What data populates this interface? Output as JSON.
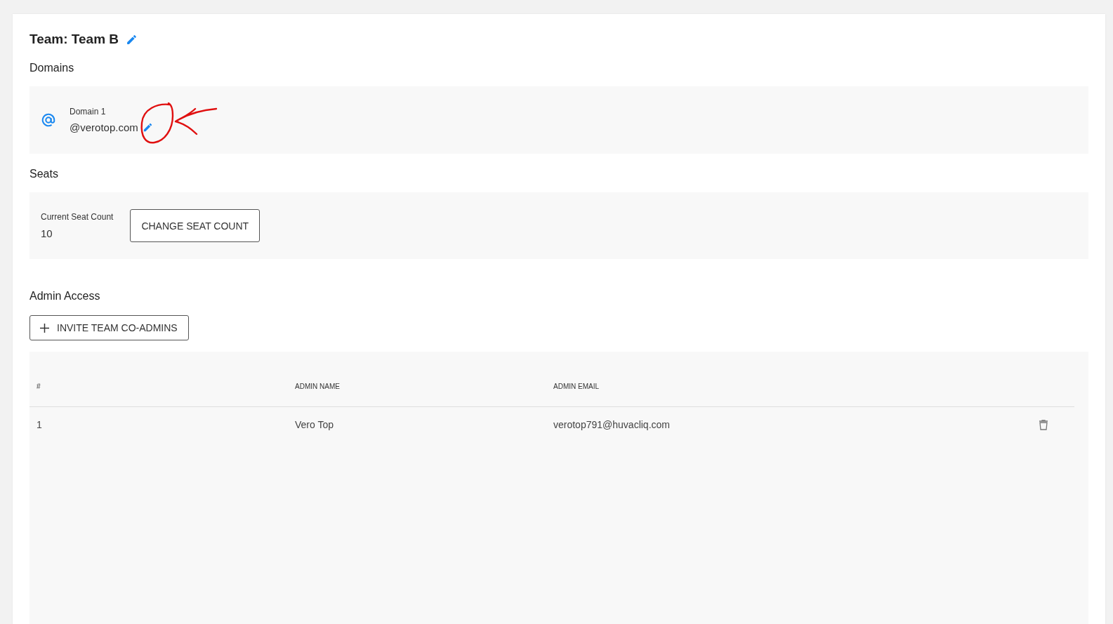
{
  "team": {
    "title": "Team: Team B"
  },
  "domains": {
    "heading": "Domains",
    "items": [
      {
        "label": "Domain 1",
        "value": "@verotop.com"
      }
    ]
  },
  "seats": {
    "heading": "Seats",
    "label": "Current Seat Count",
    "value": "10",
    "button": "CHANGE SEAT COUNT"
  },
  "admin_access": {
    "heading": "Admin Access",
    "invite_button": "INVITE TEAM CO-ADMINS",
    "table": {
      "columns": [
        "#",
        "ADMIN NAME",
        "ADMIN EMAIL"
      ],
      "rows": [
        {
          "cells": [
            "1",
            "Vero Top",
            "verotop791@huvacliq.com"
          ]
        }
      ]
    }
  }
}
